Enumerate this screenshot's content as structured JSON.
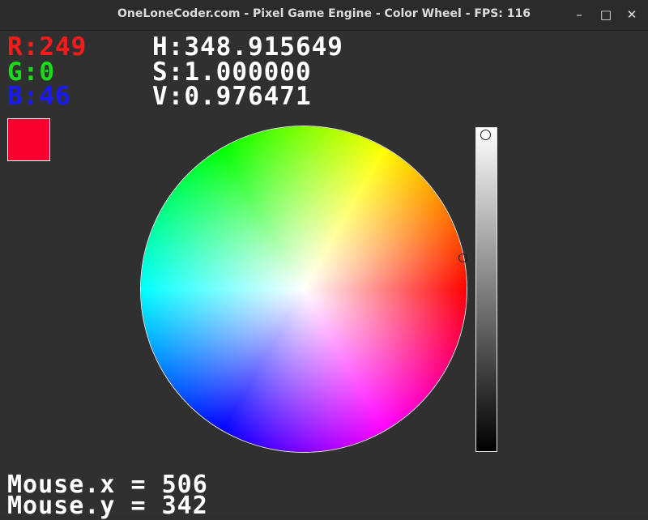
{
  "window": {
    "title": "OneLoneCoder.com - Pixel Game Engine - Color Wheel - FPS: 116",
    "buttons": {
      "minimize": "–",
      "maximize": "□",
      "close": "✕"
    }
  },
  "rgb": {
    "r": "R:249",
    "g": "G:0",
    "b": "B:46"
  },
  "hsv": {
    "h": "H:348.915649",
    "s": "S:1.000000",
    "v": "V:0.976471"
  },
  "selected_color": "#f9002e",
  "mouse": {
    "x": "Mouse.x = 506",
    "y": "Mouse.y = 342"
  },
  "colors": {
    "r_label": "#ff1a1a",
    "g_label": "#1adb1a",
    "b_label": "#1a1aff"
  },
  "value_slider": {
    "value": 0.976471
  },
  "icons": {
    "minimize": "minimize-icon",
    "maximize": "maximize-icon",
    "close": "close-icon"
  }
}
